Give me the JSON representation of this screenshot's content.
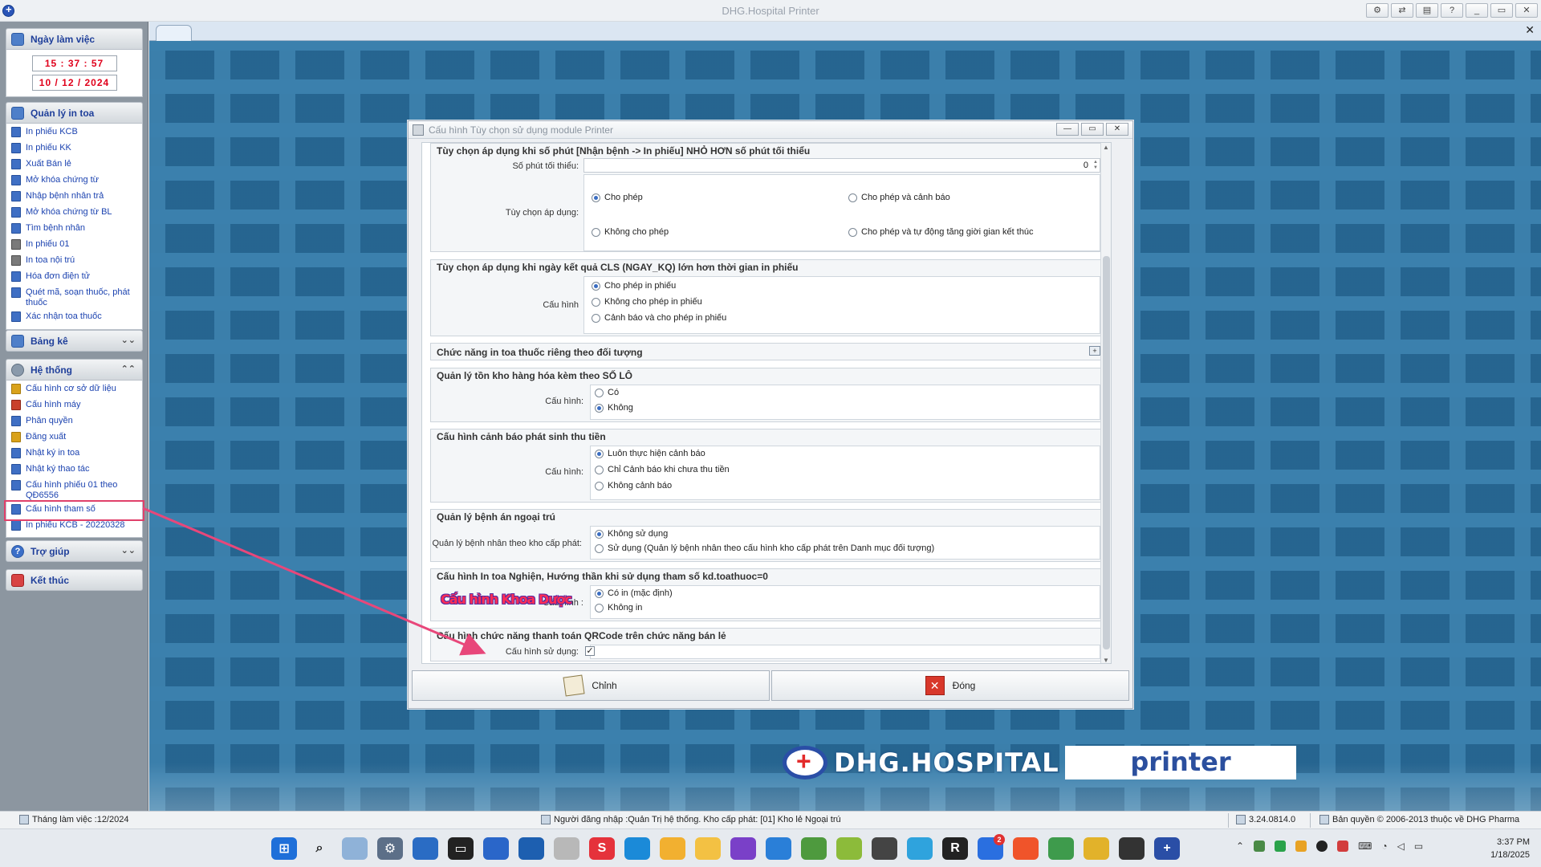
{
  "window": {
    "title": "DHG.Hospital Printer",
    "buttons": [
      "settings-icon",
      "connect-icon",
      "layout-icon",
      "?",
      "_",
      "▭",
      "✕"
    ]
  },
  "sidebar": {
    "workday": {
      "header": "Ngày làm việc",
      "time": "15 : 37 : 57",
      "date": "10 / 12 / 2024"
    },
    "print_mgmt": {
      "header": "Quản lý in toa",
      "items": [
        {
          "label": "In phiếu KCB"
        },
        {
          "label": "In phiếu KK"
        },
        {
          "label": "Xuất Bán lẻ"
        },
        {
          "label": "Mở khóa chứng từ"
        },
        {
          "label": "Nhập bệnh nhân trả"
        },
        {
          "label": "Mở khóa chứng từ BL"
        },
        {
          "label": "Tìm bệnh nhân"
        },
        {
          "label": "In phiếu 01"
        },
        {
          "label": "In toa nội trú"
        },
        {
          "label": "Hóa đơn điện tử"
        },
        {
          "label": "Quét mã, soạn thuốc, phát thuốc"
        },
        {
          "label": "Xác nhận toa thuốc"
        }
      ]
    },
    "report": {
      "header": "Bảng kê"
    },
    "system": {
      "header": "Hệ thống",
      "items": [
        {
          "label": "Cấu hình cơ sở dữ liệu"
        },
        {
          "label": "Cấu hình máy"
        },
        {
          "label": "Phân quyền"
        },
        {
          "label": "Đăng xuất"
        },
        {
          "label": "Nhật ký in toa"
        },
        {
          "label": "Nhật ký thao tác"
        },
        {
          "label": "Cấu hình phiếu 01 theo QĐ6556"
        },
        {
          "label": "Cấu hình tham số"
        },
        {
          "label": "In phiếu KCB - 20220328"
        }
      ]
    },
    "help": {
      "header": "Trợ giúp"
    },
    "end": {
      "header": "Kết thúc"
    }
  },
  "dialog": {
    "title": "Cấu hình Tùy chọn sử dụng module Printer",
    "sections": {
      "min_minutes": {
        "title": "Tùy chọn áp dụng khi  số phút [Nhận bệnh -> In phiếu] NHỎ HƠN số phút tối thiểu",
        "minutes_label": "Số phút tối thiểu:",
        "minutes_value": "0",
        "apply_label": "Tùy chọn áp dụng:",
        "options": [
          "Cho phép",
          "Cho phép và cảnh báo",
          "Không cho phép",
          "Cho phép và tự động tăng giời gian kết thúc"
        ],
        "selected": "Cho phép"
      },
      "cls": {
        "title": "Tùy chọn áp dụng khi ngày kết quả CLS (NGAY_KQ) lớn hơn thời gian in phiếu",
        "label": "Cấu hình",
        "options": [
          "Cho phép in phiếu",
          "Không cho phép in phiếu",
          "Cảnh báo và cho phép in phiếu"
        ],
        "selected": "Cho phép in phiếu"
      },
      "per_object": {
        "title": "Chức năng in toa thuốc riêng theo đối tượng"
      },
      "lot": {
        "title": "Quản lý tồn kho hàng hóa kèm theo SỐ LÔ",
        "label": "Cấu hình:",
        "options": [
          "Có",
          "Không"
        ],
        "selected": "Không"
      },
      "payment_warning": {
        "title": "Cấu hình cảnh báo phát sinh thu tiền",
        "label": "Cấu hình:",
        "options": [
          "Luôn thực hiện cảnh báo",
          "Chỉ Cảnh báo khi chưa thu tiền",
          "Không cảnh báo"
        ],
        "selected": "Luôn thực hiện cảnh báo"
      },
      "outpatient": {
        "title": "Quản lý bệnh án ngoại trú",
        "label": "Quản lý bệnh nhân theo kho cấp phát:",
        "options": [
          "Không sử dụng",
          "Sử dụng (Quản lý bệnh nhân theo cấu hình kho cấp phát trên Danh mục đối tượng)"
        ],
        "selected": "Không sử dụng"
      },
      "addiction": {
        "title": "Cấu hình In toa Nghiện, Hướng thần khi sử dụng tham số kd.toathuoc=0",
        "label": "Cấu hình :",
        "options": [
          "Có in (mặc định)",
          "Không in"
        ],
        "selected": "Có in (mặc định)",
        "overlay": "Cấu hình Khoa Dược"
      },
      "qrcode": {
        "title": "Cấu hình chức năng thanh toán QRCode trên chức năng bán lẻ",
        "label": "Cấu hình sử dụng:",
        "checked": "✓"
      }
    },
    "buttons": {
      "edit": "Chỉnh",
      "close": "Đóng"
    }
  },
  "branding": {
    "name": "DHG.HOSPITAL",
    "product": "printer"
  },
  "statusbar": {
    "month": "Tháng làm việc :12/2024",
    "user": "Người đăng nhập :Quản Trị hệ thống. Kho cấp phát: [01] Kho lẻ Ngoại trú",
    "version": "3.24.0814.0",
    "copyright": "Bản quyền © 2006-2013 thuộc về DHG Pharma"
  },
  "taskbar": {
    "time": "3:37 PM",
    "date": "1/18/2025",
    "zalo_badge": "2",
    "colors": {
      "start": "#1e6fd9",
      "brand_blue": "#2a4ea6",
      "accent_red": "#e0406a"
    }
  }
}
